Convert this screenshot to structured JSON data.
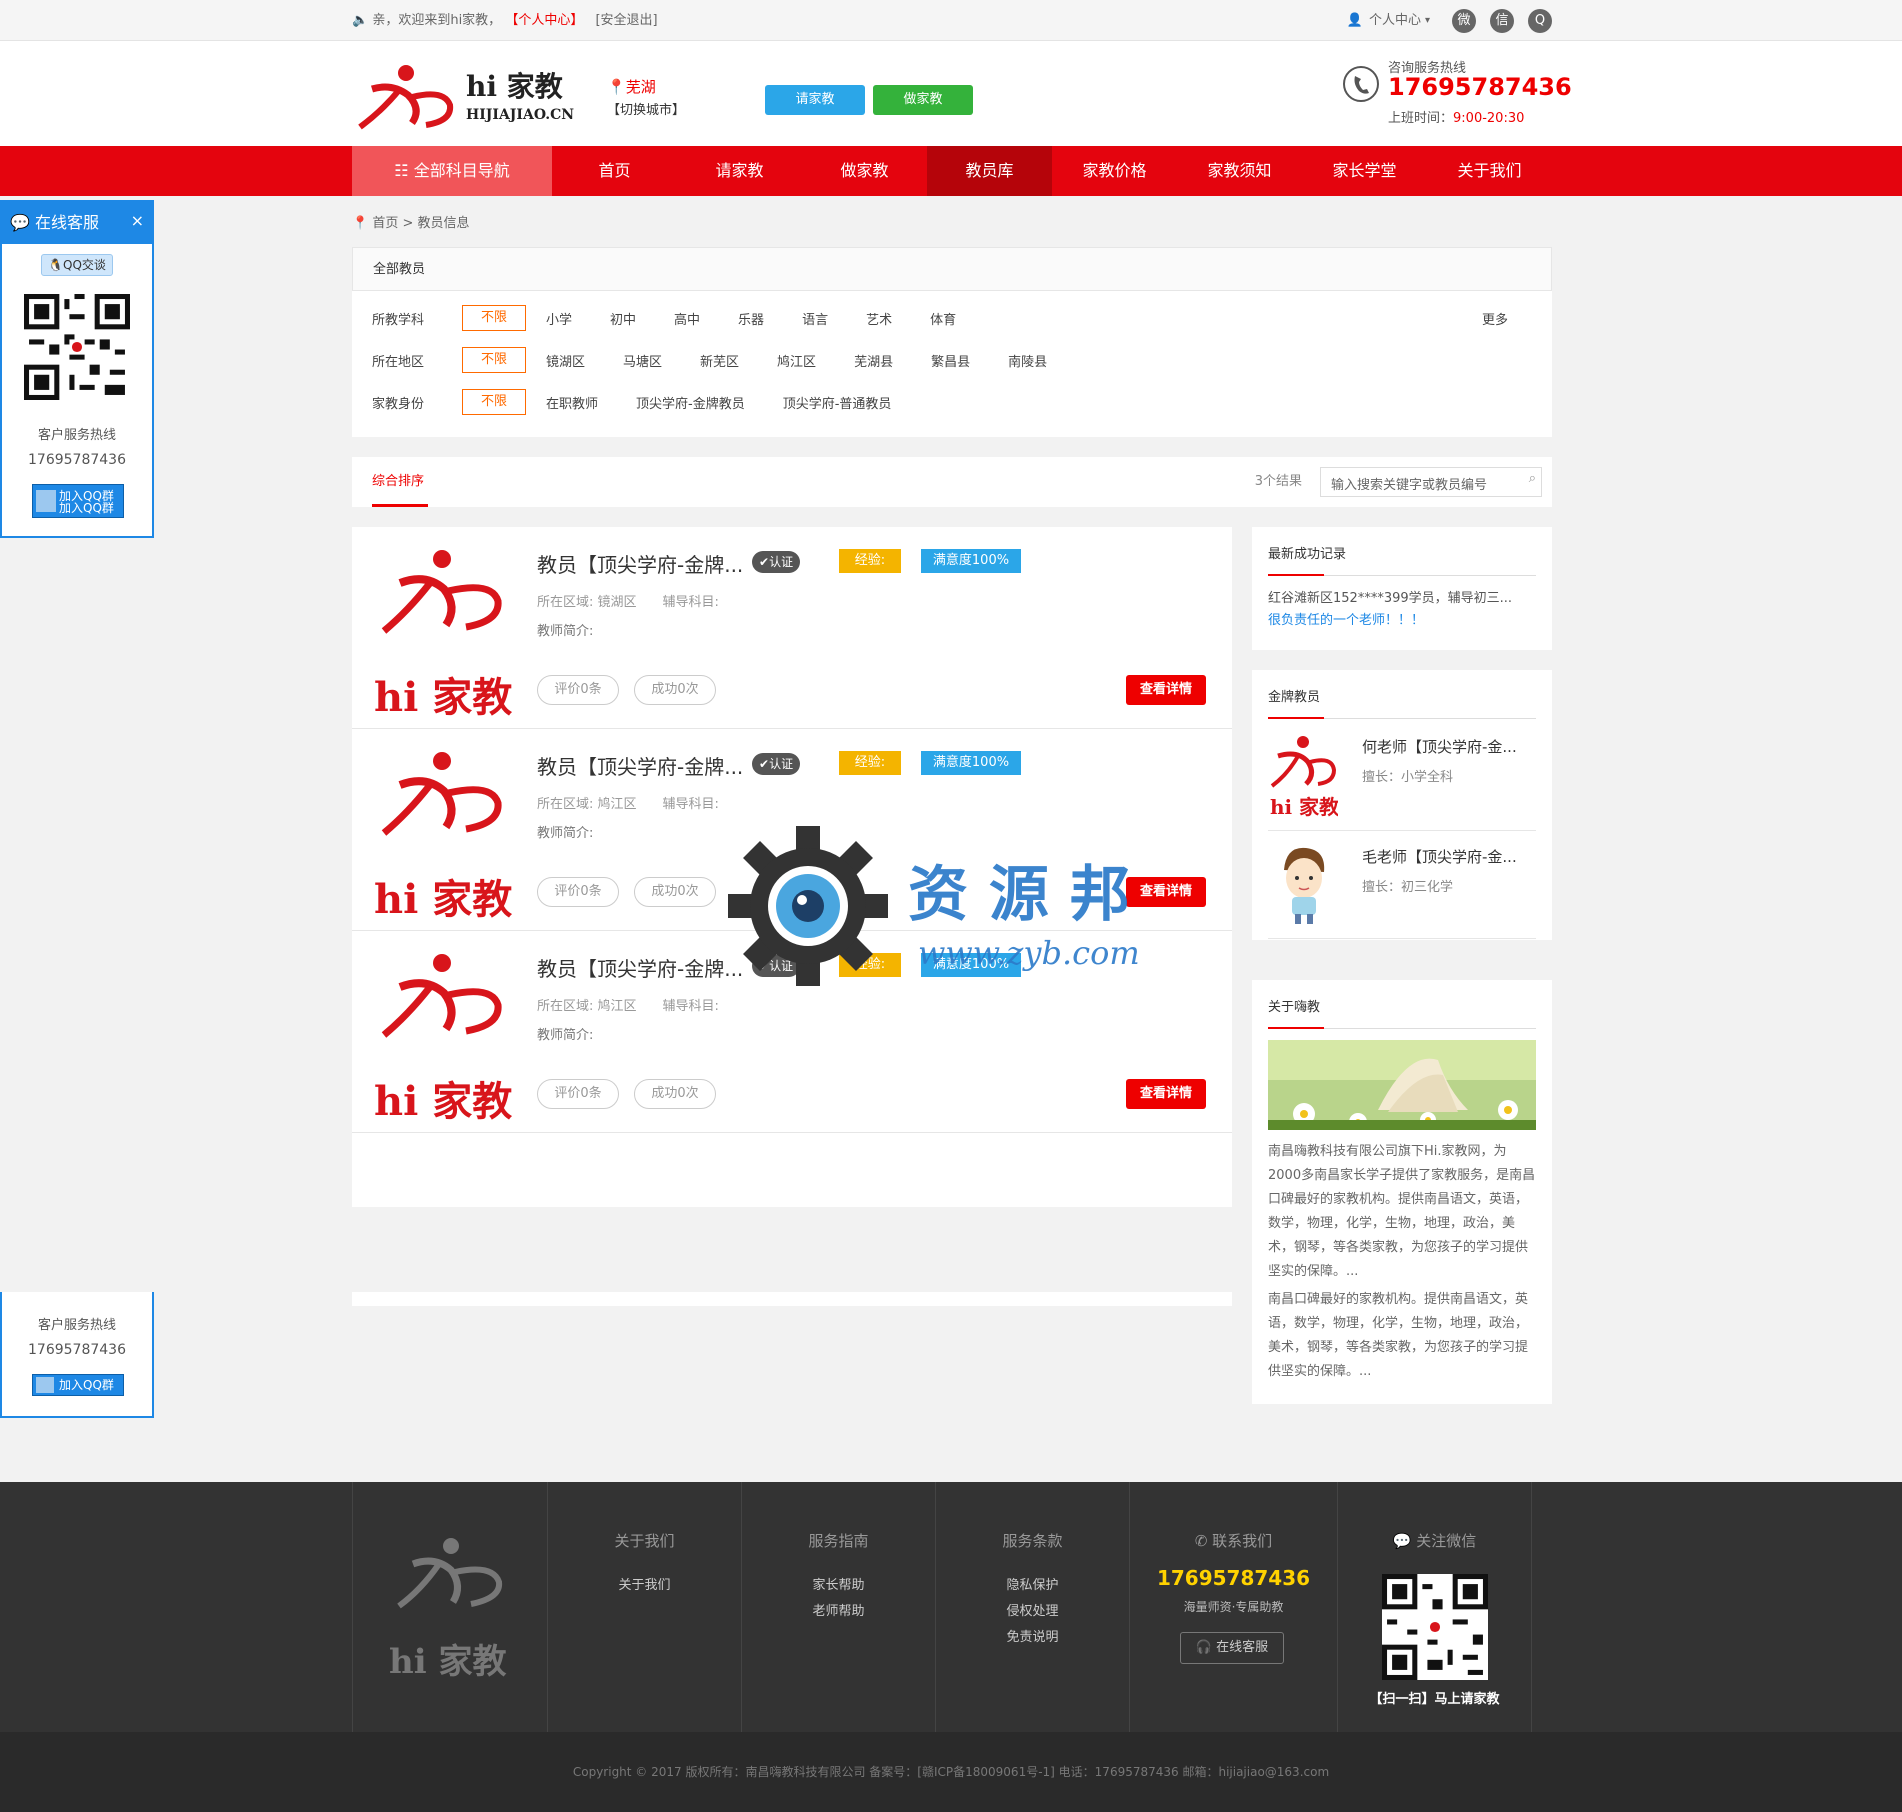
{
  "topbar": {
    "welcome": "亲，欢迎来到hi家教，",
    "center_link": "【个人中心】",
    "logout_link": "[安全退出]",
    "user_menu": "个人中心"
  },
  "header": {
    "logo_cn": "hi 家教",
    "logo_en": "HIJIAJIAO.CN",
    "city": "芜湖",
    "switch_city": "【切换城市】",
    "btn_hire": "请家教",
    "btn_tutor": "做家教",
    "hotline_label": "咨询服务热线",
    "hotline": "17695787436",
    "hours_label": "上班时间：",
    "hours": "9:00-20:30"
  },
  "nav": {
    "all": "全部科目导航",
    "items": [
      "首页",
      "请家教",
      "做家教",
      "教员库",
      "家教价格",
      "家教须知",
      "家长学堂",
      "关于我们"
    ]
  },
  "kefu": {
    "title": "在线客服",
    "qq_chat": "QQ交谈",
    "hotline_label": "客户服务热线",
    "hotline": "17695787436",
    "qq_group": "加入QQ群"
  },
  "breadcrumb": {
    "home": "首页",
    "sep": ">",
    "current": "教员信息"
  },
  "filter": {
    "head": "全部教员",
    "rows": [
      {
        "label": "所教学科",
        "selected": "不限",
        "options": [
          "小学",
          "初中",
          "高中",
          "乐器",
          "语言",
          "艺术",
          "体育"
        ],
        "more": "更多"
      },
      {
        "label": "所在地区",
        "selected": "不限",
        "options": [
          "镜湖区",
          "马塘区",
          "新芜区",
          "鸠江区",
          "芜湖县",
          "繁昌县",
          "南陵县"
        ]
      },
      {
        "label": "家教身份",
        "selected": "不限",
        "options": [
          "在职教师",
          "顶尖学府-金牌教员",
          "顶尖学府-普通教员"
        ]
      }
    ]
  },
  "sortbar": {
    "tab": "综合排序",
    "results": "3个结果",
    "search_placeholder": "输入搜索关键字或教员编号"
  },
  "teachers": [
    {
      "name": "教员【顶尖学府-金牌...",
      "cert": "认证",
      "exp": "经验:",
      "sat": "满意度100%",
      "area_label": "所在区域:",
      "area": "镜湖区",
      "subject_label": "辅导科目:",
      "intro_label": "教师简介:",
      "reviews": "评价0条",
      "success": "成功0次",
      "detail": "查看详情"
    },
    {
      "name": "教员【顶尖学府-金牌...",
      "cert": "认证",
      "exp": "经验:",
      "sat": "满意度100%",
      "area_label": "所在区域:",
      "area": "鸠江区",
      "subject_label": "辅导科目:",
      "intro_label": "教师简介:",
      "reviews": "评价0条",
      "success": "成功0次",
      "detail": "查看详情"
    },
    {
      "name": "教员【顶尖学府-金牌...",
      "cert": "认证",
      "exp": "经验:",
      "sat": "满意度100%",
      "area_label": "所在区域:",
      "area": "鸠江区",
      "subject_label": "辅导科目:",
      "intro_label": "教师简介:",
      "reviews": "评价0条",
      "success": "成功0次",
      "detail": "查看详情"
    }
  ],
  "sidebar": {
    "latest_title": "最新成功记录",
    "latest_text": "红谷滩新区152****399学员，辅导初三...",
    "latest_quote": "很负责任的一个老师！！！",
    "gold_title": "金牌教员",
    "gold": [
      {
        "name": "何老师【顶尖学府-金...",
        "specialty": "擅长：小学全科"
      },
      {
        "name": "毛老师【顶尖学府-金...",
        "specialty": "擅长：初三化学"
      }
    ],
    "about_title": "关于嗨教",
    "about_text": "南昌嗨教科技有限公司旗下Hi.家教网，为2000多南昌家长学子提供了家教服务，是南昌口碑最好的家教机构。提供南昌语文，英语，数学，物理，化学，生物，地理，政治，美术，钢琴，等各类家教，为您孩子的学习提供坚实的保障。...",
    "about_text2": "南昌口碑最好的家教机构。提供南昌语文，英语，数学，物理，化学，生物，地理，政治，美术，钢琴，等各类家教，为您孩子的学习提供坚实的保障。..."
  },
  "footer": {
    "logo": "hi 家教",
    "about_title": "关于我们",
    "about_links": [
      "关于我们"
    ],
    "guide_title": "服务指南",
    "guide_links": [
      "家长帮助",
      "老师帮助"
    ],
    "terms_title": "服务条款",
    "terms_links": [
      "隐私保护",
      "侵权处理",
      "免责说明"
    ],
    "contact_title": "联系我们",
    "contact_phone": "17695787436",
    "contact_sub": "海量师资·专属助教",
    "contact_btn": "在线客服",
    "wechat_title": "关注微信",
    "wechat_caption": "【扫一扫】马上请家教",
    "copyright": "Copyright © 2017 版权所有：南昌嗨教科技有限公司    备案号：[赣ICP备18009061号-1]    电话：17695787436    邮箱：hijiajiao@163.com"
  },
  "watermark": {
    "cn": "资 源 邦",
    "url": "www.zyb.com"
  },
  "colors": {
    "brand_red": "#e4040e",
    "nav_active": "#b5040a",
    "accent_blue": "#2ba6e8",
    "accent_green": "#34b23b",
    "accent_orange": "#ff6a00"
  }
}
